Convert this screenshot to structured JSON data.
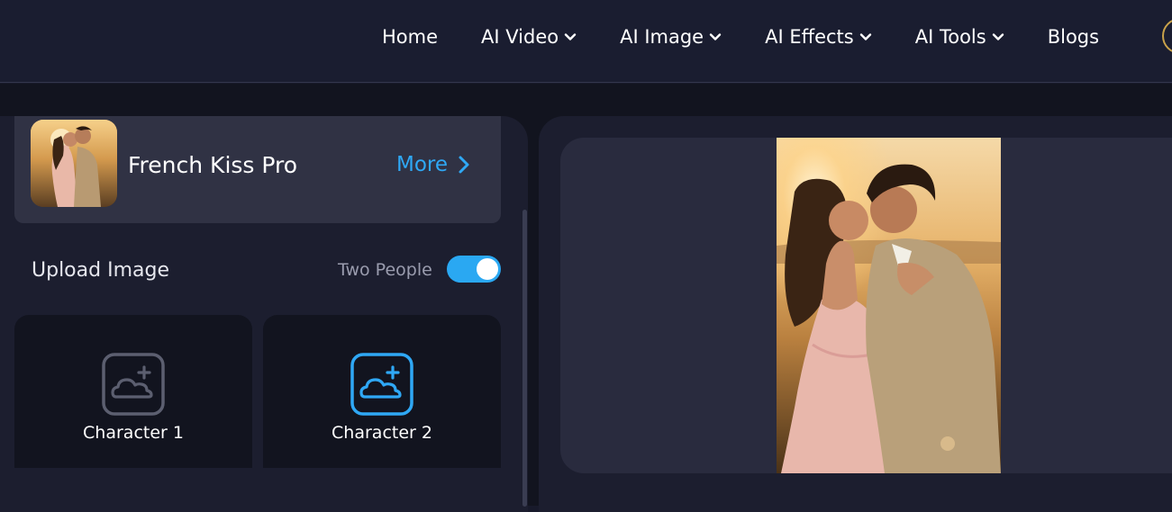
{
  "nav": {
    "items": [
      {
        "label": "Home",
        "has_dropdown": false
      },
      {
        "label": "AI Video",
        "has_dropdown": true
      },
      {
        "label": "AI Image",
        "has_dropdown": true
      },
      {
        "label": "AI Effects",
        "has_dropdown": true
      },
      {
        "label": "AI Tools",
        "has_dropdown": true
      },
      {
        "label": "Blogs",
        "has_dropdown": false
      }
    ]
  },
  "effect": {
    "title": "French Kiss Pro",
    "more_label": "More"
  },
  "upload": {
    "label": "Upload Image",
    "two_people_label": "Two People",
    "two_people_enabled": true,
    "characters": [
      {
        "label": "Character 1",
        "active": false
      },
      {
        "label": "Character 2",
        "active": true
      }
    ]
  },
  "colors": {
    "accent": "#2fa8f5",
    "toggle_on": "#2aa8f2",
    "inactive_icon": "#5c5f70"
  },
  "icons": {
    "nav_chevron": "chevron-down-icon",
    "more_chevron": "chevron-right-icon",
    "upload": "image-upload-icon"
  }
}
